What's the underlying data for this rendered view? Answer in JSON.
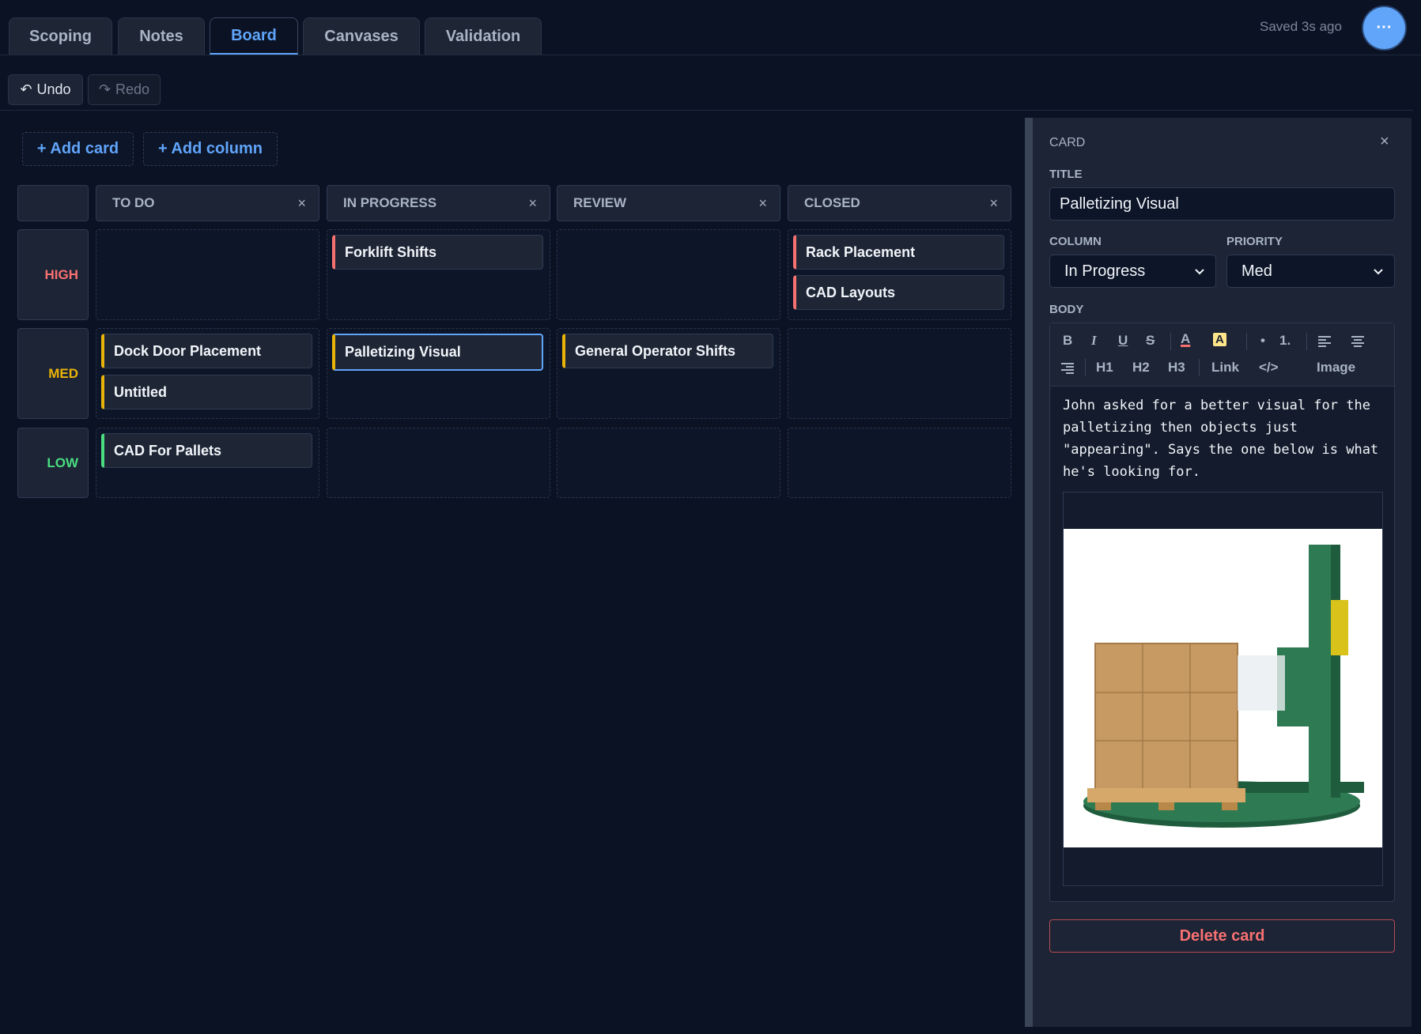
{
  "tabs": [
    "Scoping",
    "Notes",
    "Board",
    "Canvases",
    "Validation"
  ],
  "active_tab": "Board",
  "saved_status": "Saved 3s ago",
  "menu_label": "···",
  "toolbar": {
    "undo": "Undo",
    "redo": "Redo",
    "undo_icon": "↶",
    "redo_icon": "↷"
  },
  "board": {
    "add_card": "+ Add card",
    "add_column": "+ Add column",
    "columns": [
      "TO DO",
      "IN PROGRESS",
      "REVIEW",
      "CLOSED"
    ],
    "close_icon": "×",
    "rows": [
      {
        "label": "HIGH",
        "color": "#f87171"
      },
      {
        "label": "MED",
        "color": "#eab308"
      },
      {
        "label": "LOW",
        "color": "#4ade80"
      }
    ],
    "cards": {
      "forklift": "Forklift Shifts",
      "rack": "Rack Placement",
      "cad_layouts": "CAD Layouts",
      "dock": "Dock Door Placement",
      "untitled": "Untitled",
      "palletizing": "Palletizing Visual",
      "general": "General Operator Shifts",
      "cad_pallets": "CAD For Pallets"
    }
  },
  "panel": {
    "header": "CARD",
    "close_icon": "×",
    "title_label": "TITLE",
    "title_value": "Palletizing Visual",
    "column_label": "COLUMN",
    "column_value": "In Progress",
    "priority_label": "PRIORITY",
    "priority_value": "Med",
    "body_label": "BODY",
    "editor_tools": {
      "bold": "B",
      "italic": "I",
      "underline": "U",
      "strike": "S",
      "text_color": "A",
      "highlight": "A",
      "bullet": "•",
      "numbered": "1.",
      "h1": "H1",
      "h2": "H2",
      "h3": "H3",
      "link": "Link",
      "code": "</>",
      "image": "Image"
    },
    "body_text": "John asked for a better visual for the palletizing then objects just \"appearing\". Says the one below is what he's looking for.",
    "delete_label": "Delete card"
  },
  "colors": {
    "accent": "#60a5fa",
    "background": "#0b1224",
    "danger": "#f87171"
  }
}
